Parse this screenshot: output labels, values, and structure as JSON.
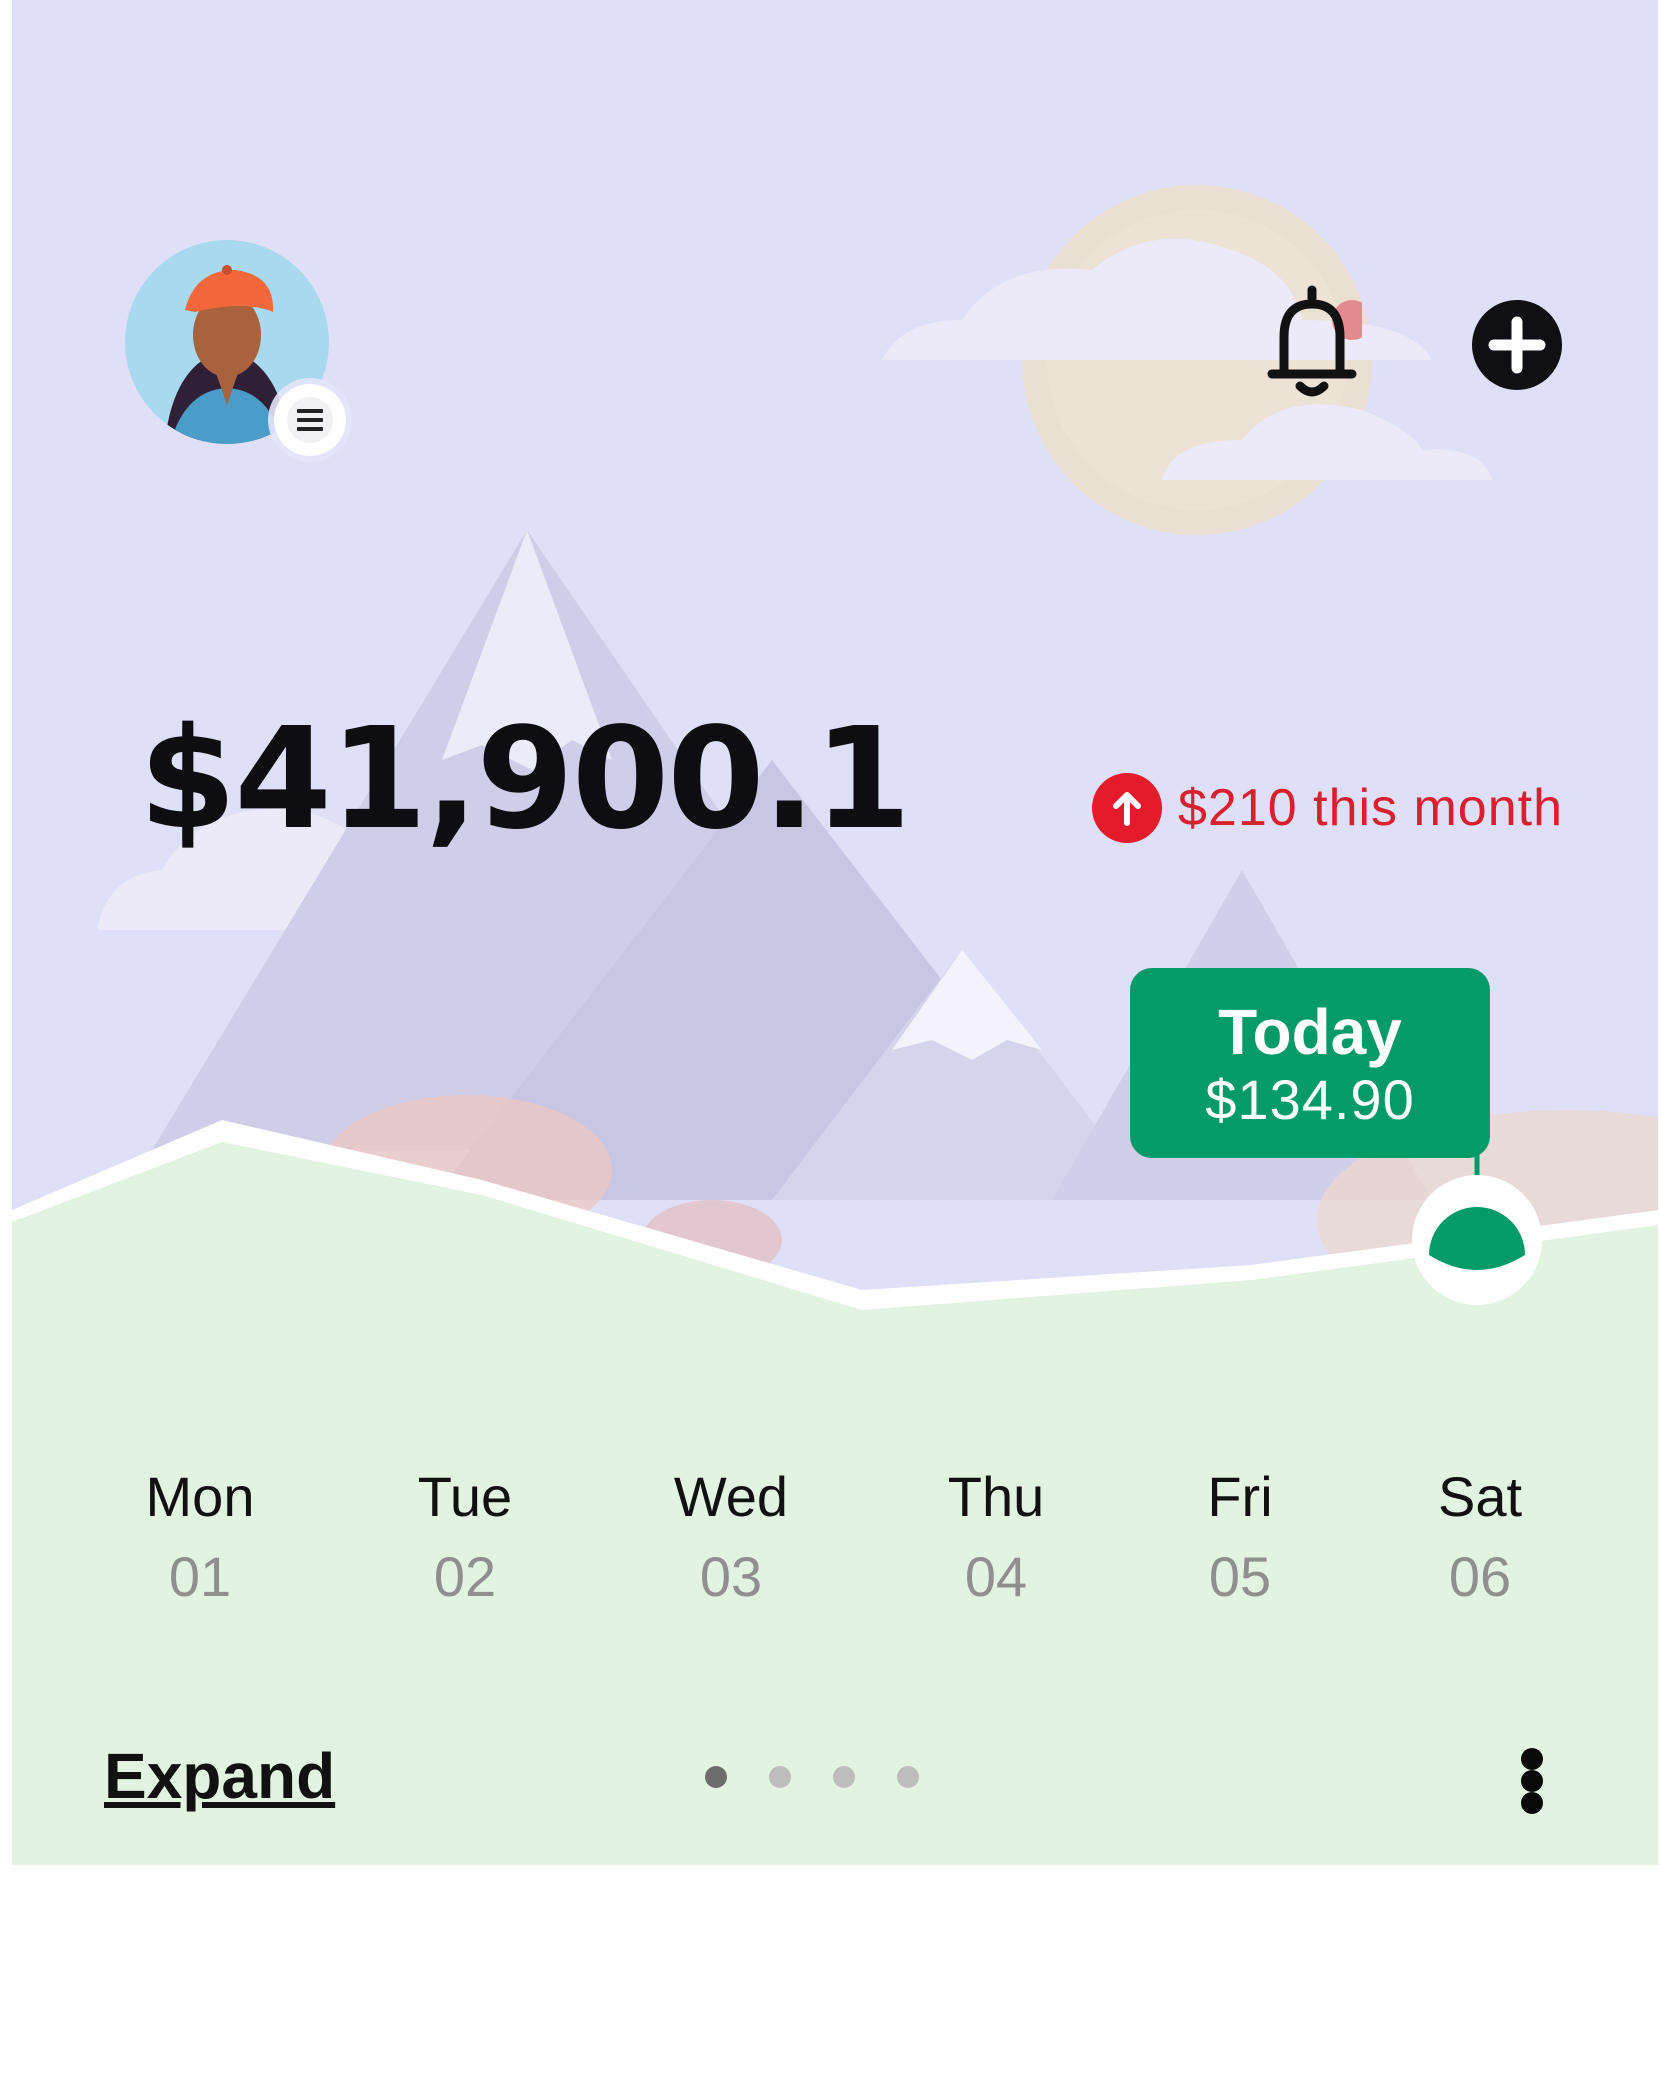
{
  "balance": {
    "amount": "$41,900.1"
  },
  "monthly_change": {
    "label": "$210 this month",
    "direction": "up",
    "color": "#d8202e"
  },
  "today_tooltip": {
    "title": "Today",
    "value": "$134.90",
    "color": "#059b69"
  },
  "header": {
    "avatar_icon": "avatar-woman-beret",
    "menu_icon": "hamburger-icon",
    "notification_icon": "bell-icon",
    "add_icon": "plus-circle-icon"
  },
  "days": [
    {
      "name": "Mon",
      "num": "01"
    },
    {
      "name": "Tue",
      "num": "02"
    },
    {
      "name": "Wed",
      "num": "03"
    },
    {
      "name": "Thu",
      "num": "04"
    },
    {
      "name": "Fri",
      "num": "05"
    },
    {
      "name": "Sat",
      "num": "06"
    }
  ],
  "footer": {
    "expand_label": "Expand",
    "page_count": 4,
    "active_page": 1,
    "more_icon": "vertical-dots-icon"
  },
  "colors": {
    "sky": "#dfe0f8",
    "ground": "#e3f3e1",
    "accent_green": "#059b69",
    "alert_red": "#e31b2a"
  }
}
